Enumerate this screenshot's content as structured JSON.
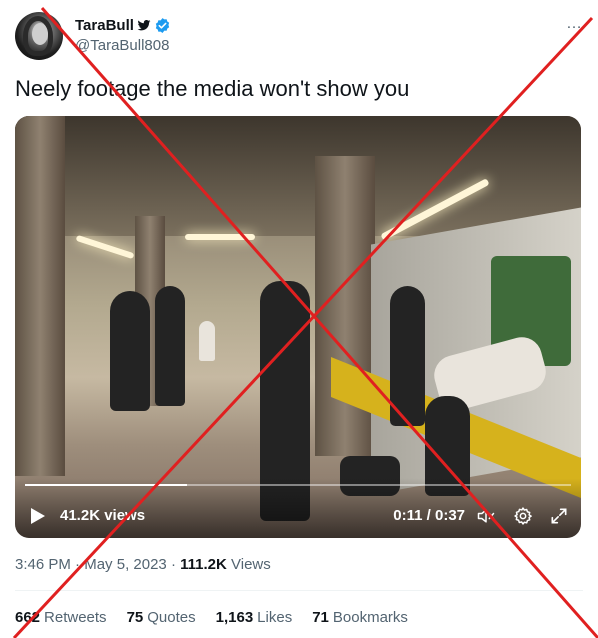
{
  "author": {
    "display_name": "TaraBull",
    "handle": "@TaraBull808",
    "avatar": "avatar-photo",
    "badge_icons": [
      "bird-icon",
      "verified-icon"
    ],
    "more_icon": "…"
  },
  "tweet": {
    "text": "Neely footage the media won't show you"
  },
  "video": {
    "views_label": "41.2K views",
    "time_label": "0:11 / 0:37",
    "progress": 0.297,
    "icons": [
      "play-icon",
      "volume-icon",
      "gear-icon",
      "fullscreen-icon"
    ]
  },
  "meta": {
    "time": "3:46 PM",
    "sep1": " · ",
    "date": "May 5, 2023",
    "sep2": " · ",
    "views_count": "111.2K",
    "views_label": " Views"
  },
  "stats": [
    {
      "count": "662",
      "label": "Retweets"
    },
    {
      "count": "75",
      "label": "Quotes"
    },
    {
      "count": "1,163",
      "label": "Likes"
    },
    {
      "count": "71",
      "label": "Bookmarks"
    }
  ],
  "colors": {
    "overlay_x": "#e02020",
    "verified": "#1d9bf0",
    "text": "#0f1419",
    "secondary": "#536471"
  }
}
